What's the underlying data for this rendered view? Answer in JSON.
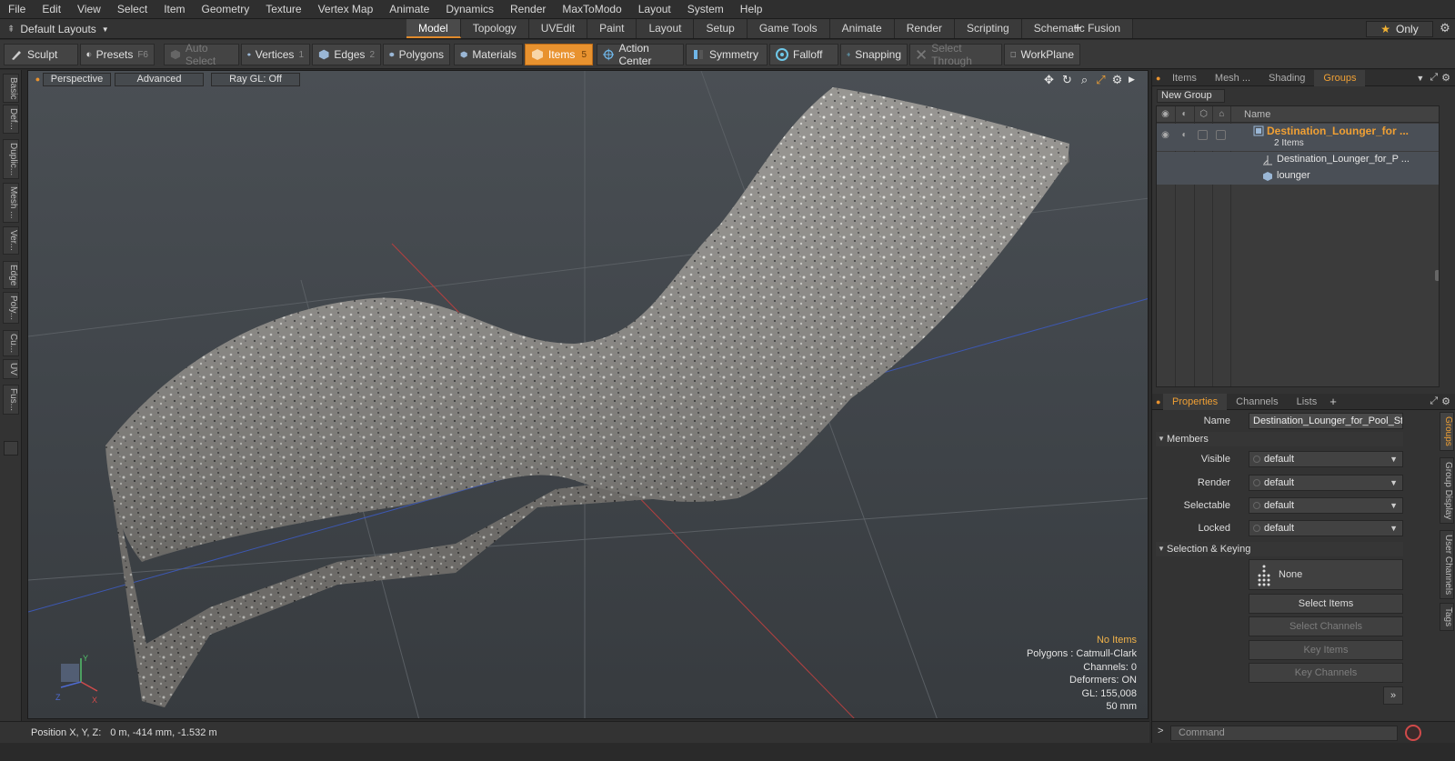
{
  "menu": [
    "File",
    "Edit",
    "View",
    "Select",
    "Item",
    "Geometry",
    "Texture",
    "Vertex Map",
    "Animate",
    "Dynamics",
    "Render",
    "MaxToModo",
    "Layout",
    "System",
    "Help"
  ],
  "layout_select": "Default Layouts",
  "tabs": [
    "Model",
    "Topology",
    "UVEdit",
    "Paint",
    "Layout",
    "Setup",
    "Game Tools",
    "Animate",
    "Render",
    "Scripting",
    "Schematic Fusion"
  ],
  "active_tab": "Model",
  "only_label": "Only",
  "toolbar": {
    "sculpt": "Sculpt",
    "presets": "Presets",
    "presets_key": "F6",
    "auto_select": "Auto Select",
    "vertices": "Vertices",
    "vertices_key": "1",
    "edges": "Edges",
    "edges_key": "2",
    "polygons": "Polygons",
    "materials": "Materials",
    "items": "Items",
    "items_key": "5",
    "action_center": "Action Center",
    "symmetry": "Symmetry",
    "falloff": "Falloff",
    "snapping": "Snapping",
    "select_through": "Select Through",
    "workplane": "WorkPlane"
  },
  "left_tabs": [
    "Basic",
    "Def...",
    "Duplic...",
    "Mesh ...",
    "Ver...",
    "Edge",
    "Poly...",
    "Cu...",
    "UV",
    "Fus..."
  ],
  "viewport": {
    "perspective": "Perspective",
    "advanced": "Advanced",
    "raygl": "Ray GL: Off",
    "info": {
      "no_items": "No Items",
      "polygons": "Polygons : Catmull-Clark",
      "channels": "Channels: 0",
      "deformers": "Deformers: ON",
      "gl": "GL: 155,008",
      "focal": "50 mm"
    },
    "axis_labels": {
      "x": "X",
      "y": "Y",
      "z": "Z"
    }
  },
  "status": {
    "label": "Position X, Y, Z:",
    "value": "0 m, -414 mm, -1.532 m"
  },
  "right_tabs": [
    "Items",
    "Mesh ...",
    "Shading",
    "Groups"
  ],
  "active_right_tab": "Groups",
  "new_group": "New Group",
  "tree": {
    "header_name": "Name",
    "group_name": "Destination_Lounger_for ...",
    "group_count": "2 Items",
    "children": [
      "Destination_Lounger_for_P ...",
      "lounger"
    ]
  },
  "props_tabs": [
    "Properties",
    "Channels",
    "Lists"
  ],
  "active_props_tab": "Properties",
  "props": {
    "name_label": "Name",
    "name_value": "Destination_Lounger_for_Pool_St",
    "members_section": "Members",
    "visible_label": "Visible",
    "visible_value": "default",
    "render_label": "Render",
    "render_value": "default",
    "selectable_label": "Selectable",
    "selectable_value": "default",
    "locked_label": "Locked",
    "locked_value": "default",
    "selection_section": "Selection & Keying",
    "none_label": "None",
    "select_items": "Select Items",
    "select_channels": "Select Channels",
    "key_items": "Key Items",
    "key_channels": "Key Channels"
  },
  "right_vtabs": [
    "Groups",
    "Group Display",
    "User Channels",
    "Tags"
  ],
  "command_placeholder": "Command",
  "colors": {
    "accent": "#e8922f",
    "group_orange": "#f0a034"
  }
}
